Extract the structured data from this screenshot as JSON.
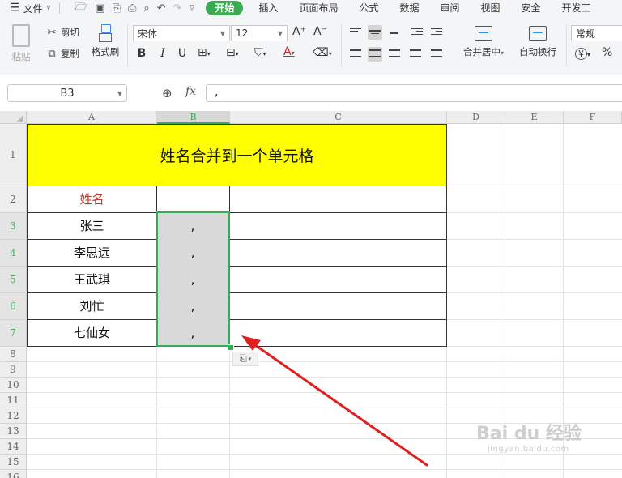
{
  "menubar": {
    "file_label": "文件",
    "tabs": [
      {
        "label": "开始",
        "active": true
      },
      {
        "label": "插入",
        "active": false
      },
      {
        "label": "页面布局",
        "active": false
      },
      {
        "label": "公式",
        "active": false
      },
      {
        "label": "数据",
        "active": false
      },
      {
        "label": "审阅",
        "active": false
      },
      {
        "label": "视图",
        "active": false
      },
      {
        "label": "安全",
        "active": false
      },
      {
        "label": "开发工",
        "active": false
      }
    ],
    "accent_color": "#3aab53"
  },
  "ribbon": {
    "paste_label": "粘贴",
    "cut_label": "剪切",
    "copy_label": "复制",
    "format_painter_label": "格式刷",
    "font_name": "宋体",
    "font_size": "12",
    "bold": "B",
    "italic": "I",
    "underline": "U",
    "grow_font": "A⁺",
    "shrink_font": "A⁻",
    "font_color_letter": "A",
    "merge_center_label": "合并居中",
    "wrap_text_label": "自动换行",
    "number_format": "常规",
    "currency_symbol": "¥",
    "percent_symbol": "%"
  },
  "formula_bar": {
    "name_box": "B3",
    "fx_label": "fx",
    "formula": ","
  },
  "sheet": {
    "columns": [
      "A",
      "B",
      "C",
      "D",
      "E",
      "F"
    ],
    "rows": [
      "1",
      "2",
      "3",
      "4",
      "5",
      "6",
      "7",
      "8",
      "9",
      "10",
      "11",
      "12",
      "13",
      "14",
      "15",
      "16"
    ],
    "title": "姓名合并到一个单元格",
    "title_fill": "#ffff00",
    "header_name": "姓名",
    "header_color": "#c0392b",
    "names": [
      "张三",
      "李思远",
      "王武琪",
      "刘忙",
      "七仙女"
    ],
    "b_values": [
      ",",
      ",",
      ",",
      ",",
      ","
    ],
    "selected_cell": "B3",
    "selected_column": "B",
    "selected_rows": [
      "3",
      "4",
      "5",
      "6",
      "7"
    ],
    "annotation_arrow_color": "#e02020"
  },
  "watermark": {
    "logo": "Bai du 经验",
    "url": "jingyan.baidu.com"
  }
}
